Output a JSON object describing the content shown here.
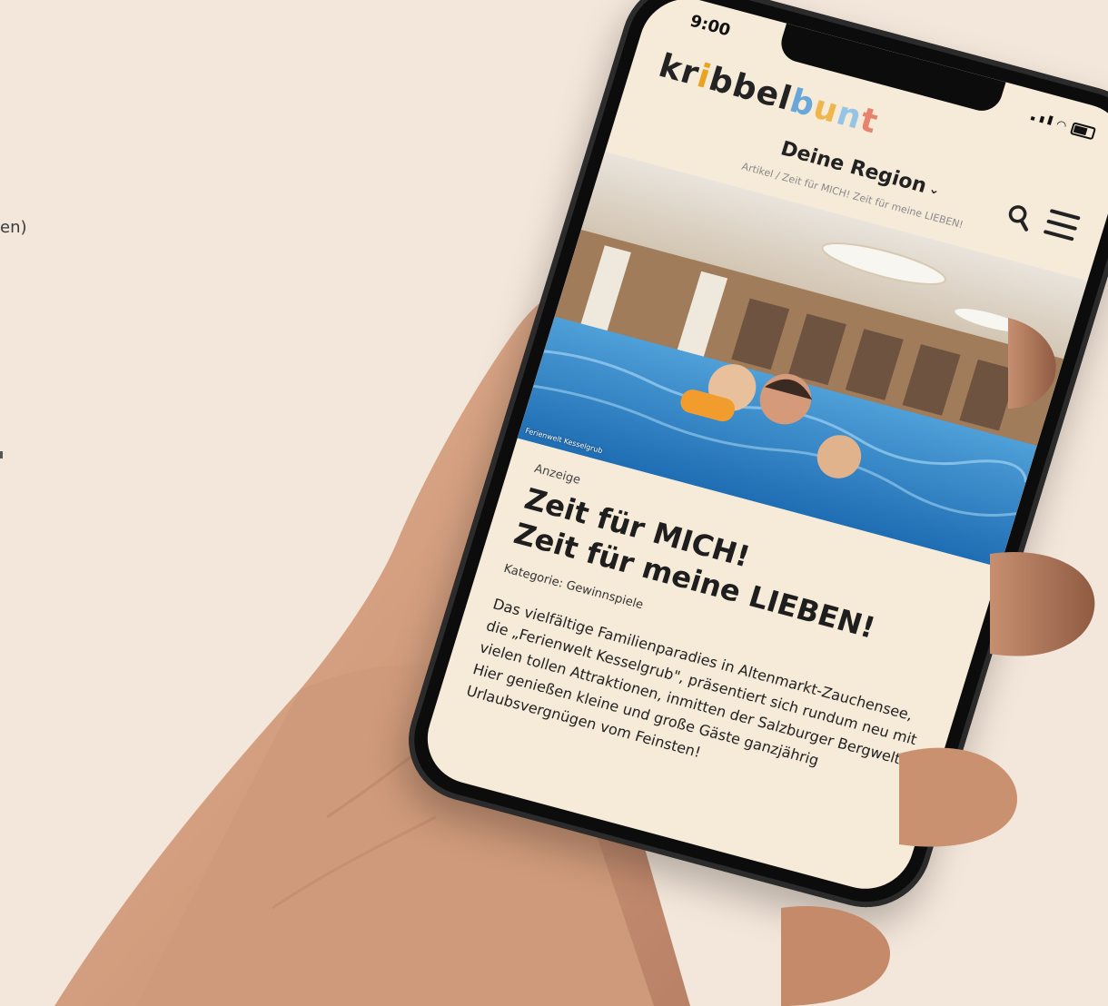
{
  "edge_fragment": {
    "text": "en)"
  },
  "phone": {
    "status_bar": {
      "time": "9:00"
    },
    "site": {
      "logo": {
        "part_dark": "kr",
        "part_i": "i",
        "part_bbel": "bbel",
        "part_b": "b",
        "part_u": "u",
        "part_n": "n",
        "part_t": "t"
      },
      "region_label": "Deine Region",
      "breadcrumb": "Artikel / Zeit für MICH! Zeit für meine LIEBEN!"
    },
    "hero_image": {
      "credit": "Ferienwelt Kesselgrub"
    },
    "article": {
      "label": "Anzeige",
      "title_line1": "Zeit für MICH!",
      "title_line2": "Zeit für meine LIEBEN!",
      "category": "Kategorie: Gewinnspiele",
      "body": "Das vielfältige Familienparadies in Altenmarkt-Zauchensee, die „Ferienwelt Kesselgrub\", präsentiert sich rundum neu mit vielen tollen Attraktionen, inmitten der Salzburger Bergwelt. Hier genießen kleine und große Gäste ganzjährig Urlaubsvergnügen vom Feinsten!"
    }
  },
  "colors": {
    "background": "#f3e6da",
    "screen": "#f6ead9",
    "phone_frame": "#0c0c0c",
    "skin": "#d9a686"
  }
}
